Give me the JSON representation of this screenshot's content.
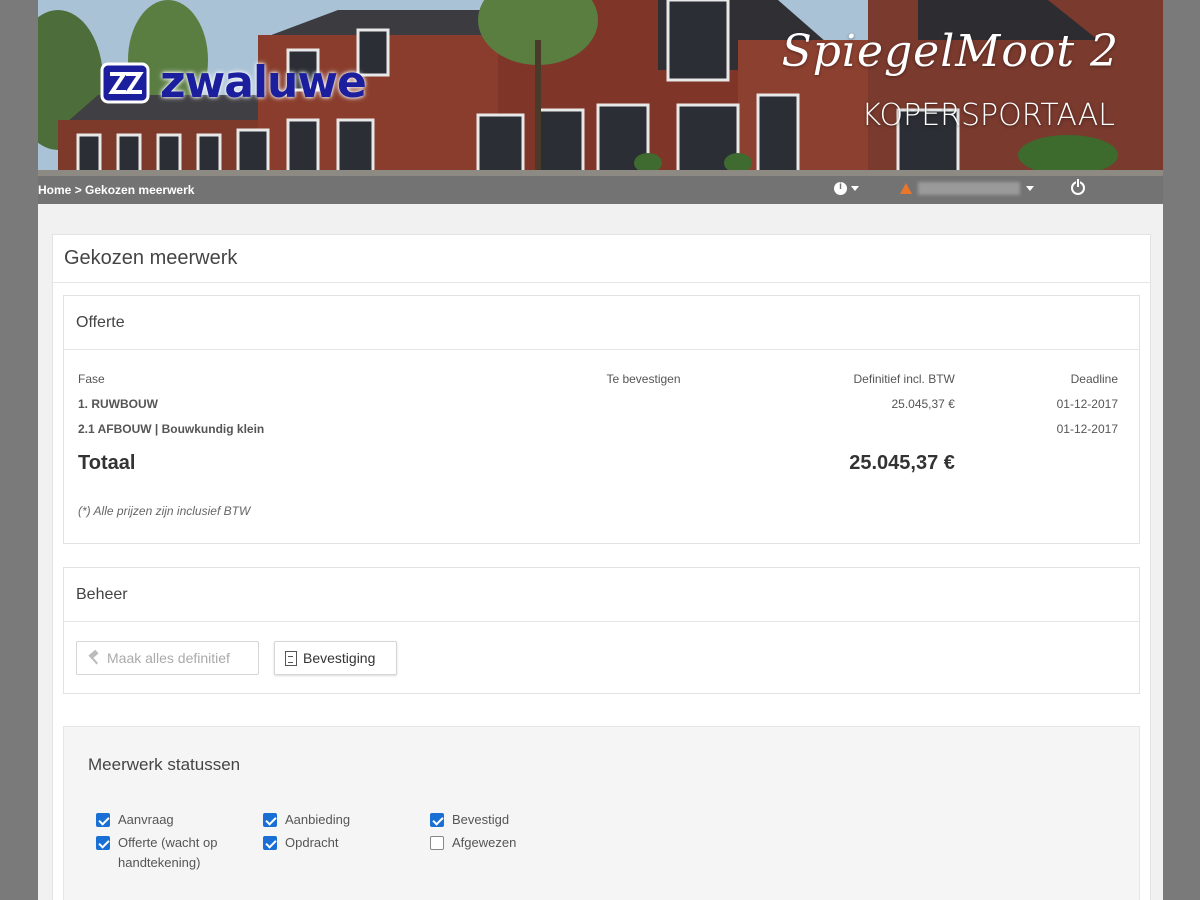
{
  "banner": {
    "brand": "zwaluwe",
    "project": "SpiegelMoot 2",
    "portal": "KOPERSPORTAAL"
  },
  "navbar": {
    "breadcrumb": [
      "Home",
      "Gekozen meerwerk"
    ],
    "breadcrumb_separator": ">",
    "info_icon": "info-icon",
    "warning_icon": "warning-icon",
    "user_name": "",
    "logout_icon": "power-icon"
  },
  "main": {
    "title": "Gekozen meerwerk"
  },
  "offerte": {
    "title": "Offerte",
    "columns": {
      "fase": "Fase",
      "te_bevestigen": "Te bevestigen",
      "definitief": "Definitief incl. BTW",
      "deadline": "Deadline"
    },
    "rows": [
      {
        "fase": "1. RUWBOUW",
        "te_bevestigen": "",
        "definitief": "25.045,37 €",
        "deadline": "01-12-2017"
      },
      {
        "fase": "2.1 AFBOUW | Bouwkundig klein",
        "te_bevestigen": "",
        "definitief": "",
        "deadline": "01-12-2017"
      }
    ],
    "total_label": "Totaal",
    "total_value": "25.045,37 €",
    "note": "(*) Alle prijzen zijn inclusief BTW"
  },
  "beheer": {
    "title": "Beheer",
    "btn_definitief": "Maak alles definitief",
    "btn_bevestiging": "Bevestiging"
  },
  "statussen": {
    "title": "Meerwerk statussen",
    "items": [
      {
        "label": "Aanvraag",
        "checked": true
      },
      {
        "label": "Offerte (wacht op handtekening)",
        "checked": true
      },
      {
        "label": "Aanbieding",
        "checked": true
      },
      {
        "label": "Opdracht",
        "checked": true
      },
      {
        "label": "Bevestigd",
        "checked": true
      },
      {
        "label": "Afgewezen",
        "checked": false
      }
    ]
  },
  "colors": {
    "brand_blue": "#1b1f9e",
    "navbar": "#737373",
    "checkbox_blue": "#1a6fd4",
    "warning": "#e8762c"
  }
}
